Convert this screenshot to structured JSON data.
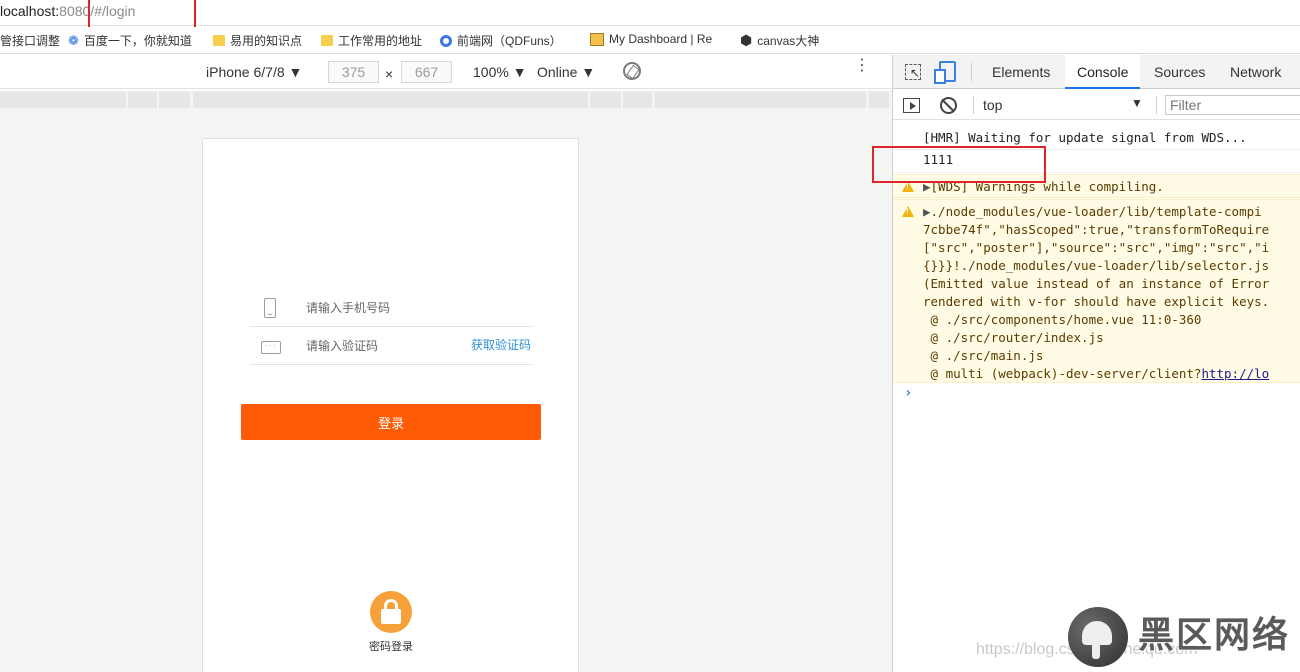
{
  "browser": {
    "url_host": "localhost:",
    "url_port_path": "8080/#/login"
  },
  "bookmarks": [
    {
      "label": "管接口调整",
      "icon": "none"
    },
    {
      "label": "百度一下，你就知道",
      "icon": "paw-icon"
    },
    {
      "label": "易用的知识点",
      "icon": "folder-icon"
    },
    {
      "label": "工作常用的地址",
      "icon": "folder-icon"
    },
    {
      "label": "前端网（QDFuns）",
      "icon": "ring-icon"
    },
    {
      "label": "My Dashboard | Re",
      "icon": "dashboard-icon"
    },
    {
      "label": "canvas大神",
      "icon": "codepen-icon"
    }
  ],
  "device_toolbar": {
    "device": "iPhone 6/7/8 ▼",
    "width": "375",
    "times": "×",
    "height": "667",
    "zoom": "100% ▼",
    "network": "Online ▼"
  },
  "login": {
    "phone_placeholder": "请输入手机号码",
    "code_placeholder": "请输入验证码",
    "get_code": "获取验证码",
    "login_button": "登录",
    "password_login": "密码登录"
  },
  "devtools": {
    "tabs": [
      "Elements",
      "Console",
      "Sources",
      "Network"
    ],
    "active_tab": "Console",
    "context": "top",
    "filter_placeholder": "Filter",
    "logs": [
      "[HMR] Waiting for update signal from WDS...",
      "1111"
    ],
    "warning1": "[WDS] Warnings while compiling.",
    "warning2_lines": [
      "./node_modules/vue-loader/lib/template-compi",
      "7cbbe74f\",\"hasScoped\":true,\"transformToRequire",
      "[\"src\",\"poster\"],\"source\":\"src\",\"img\":\"src\",\"i",
      "{}}}!./node_modules/vue-loader/lib/selector.js",
      "(Emitted value instead of an instance of Error",
      "rendered with v-for should have explicit keys.",
      " @ ./src/components/home.vue 11:0-360",
      " @ ./src/router/index.js",
      " @ ./src/main.js"
    ],
    "warning2_last_prefix": " @ multi (webpack)-dev-server/client?",
    "warning2_last_link": "http://lo",
    "prompt": "›"
  },
  "watermark": {
    "name": "黑区网络",
    "url": "https://blog.csdn.net/heiqu.com"
  },
  "colors": {
    "login_button": "#ff5a05",
    "get_code_link": "#2f8fd8",
    "highlight_box": "#e0242b",
    "active_tab_underline": "#1a73e8",
    "warning_bg": "#fffbe5"
  }
}
